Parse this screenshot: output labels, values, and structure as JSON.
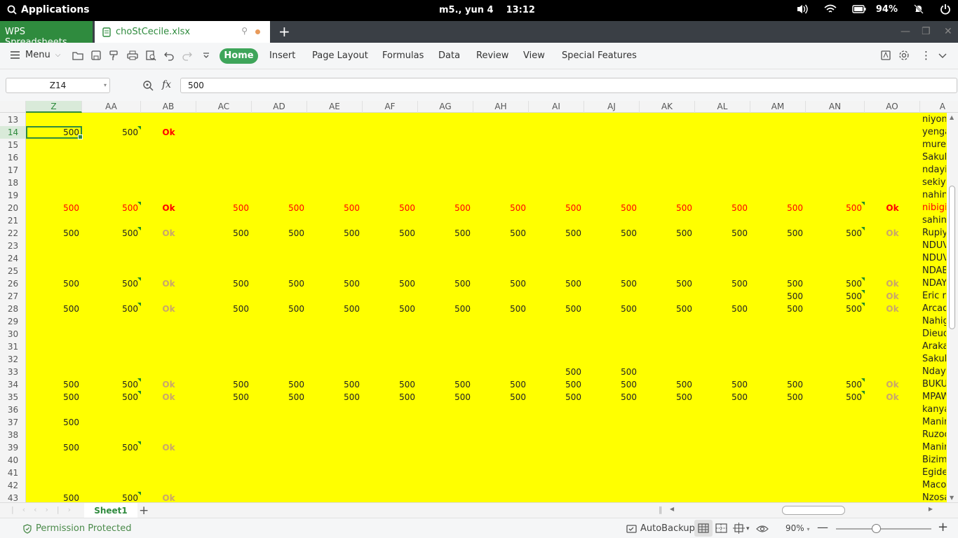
{
  "system": {
    "applications": "Applications",
    "date": "m5., yun  4",
    "time": "13:12",
    "battery": "94%"
  },
  "tabs": {
    "app": "WPS Spreadsheets",
    "file": "choStCecile.xlsx"
  },
  "ribbon": {
    "menu": "Menu",
    "items": [
      "Home",
      "Insert",
      "Page Layout",
      "Formulas",
      "Data",
      "Review",
      "View",
      "Special Features"
    ]
  },
  "formula_bar": {
    "cell_ref": "Z14",
    "fx": "fx",
    "value": "500"
  },
  "columns": [
    "Z",
    "AA",
    "AB",
    "AC",
    "AD",
    "AE",
    "AF",
    "AG",
    "AH",
    "AI",
    "AJ",
    "AK",
    "AL",
    "AM",
    "AN",
    "AO",
    "A"
  ],
  "rows": [
    "13",
    "14",
    "15",
    "16",
    "17",
    "18",
    "19",
    "20",
    "21",
    "22",
    "23",
    "24",
    "25",
    "26",
    "27",
    "28",
    "29",
    "30",
    "31",
    "32",
    "33",
    "34",
    "35",
    "36",
    "37",
    "38",
    "39",
    "40",
    "41",
    "42",
    "43"
  ],
  "cells": {
    "z14": "500",
    "aa14": "500",
    "ab14": "Ok",
    "z20": "500",
    "aa20": "500",
    "ab20": "Ok",
    "ac20": "500",
    "ad20": "500",
    "ae20": "500",
    "af20": "500",
    "ag20": "500",
    "ah20": "500",
    "ai20": "500",
    "aj20": "500",
    "ak20": "500",
    "al20": "500",
    "am20": "500",
    "an20": "500",
    "ao20": "Ok",
    "z22": "500",
    "aa22": "500",
    "ab22": "Ok",
    "ac22": "500",
    "ad22": "500",
    "ae22": "500",
    "af22": "500",
    "ag22": "500",
    "ah22": "500",
    "ai22": "500",
    "aj22": "500",
    "ak22": "500",
    "al22": "500",
    "am22": "500",
    "an22": "500",
    "ao22": "Ok",
    "z26": "500",
    "aa26": "500",
    "ab26": "Ok",
    "ac26": "500",
    "ad26": "500",
    "ae26": "500",
    "af26": "500",
    "ag26": "500",
    "ah26": "500",
    "ai26": "500",
    "aj26": "500",
    "ak26": "500",
    "al26": "500",
    "am26": "500",
    "an26": "500",
    "ao26": "Ok",
    "am27": "500",
    "an27": "500",
    "ao27": "Ok",
    "z28": "500",
    "aa28": "500",
    "ab28": "Ok",
    "ac28": "500",
    "ad28": "500",
    "ae28": "500",
    "af28": "500",
    "ag28": "500",
    "ah28": "500",
    "ai28": "500",
    "aj28": "500",
    "ak28": "500",
    "al28": "500",
    "am28": "500",
    "an28": "500",
    "ao28": "Ok",
    "ai33": "500",
    "aj33": "500",
    "z34": "500",
    "aa34": "500",
    "ab34": "Ok",
    "ac34": "500",
    "ad34": "500",
    "ae34": "500",
    "af34": "500",
    "ag34": "500",
    "ah34": "500",
    "ai34": "500",
    "aj34": "500",
    "ak34": "500",
    "al34": "500",
    "am34": "500",
    "an34": "500",
    "ao34": "Ok",
    "z35": "500",
    "aa35": "500",
    "ab35": "Ok",
    "ac35": "500",
    "ad35": "500",
    "ae35": "500",
    "af35": "500",
    "ag35": "500",
    "ah35": "500",
    "ai35": "500",
    "aj35": "500",
    "ak35": "500",
    "al35": "500",
    "am35": "500",
    "an35": "500",
    "ao35": "Ok",
    "z37": "500",
    "z39": "500",
    "aa39": "500",
    "ab39": "Ok",
    "z43": "500",
    "aa43": "500",
    "ab43": "Ok"
  },
  "names": [
    "niyon",
    "yenga",
    "mure",
    "Sakul",
    "ndayi",
    "sekiy",
    "nahin",
    "nibigi",
    "sahin",
    "Rupiy",
    "NDUV",
    "NDUV",
    "NDAB",
    "NDAY",
    "Eric r",
    "Arcad",
    "Nahig",
    "Dieud",
    "Araka",
    "Sakul",
    "Nday",
    "BUKU",
    "MPAW",
    "kanya",
    "Manir",
    "Ruzoo",
    "Manir",
    "Bizim",
    "Egide",
    "Maco",
    "Nzosa"
  ],
  "sheet": {
    "tab": "Sheet1"
  },
  "status": {
    "permission": "Permission Protected",
    "autobackup": "AutoBackup",
    "zoom": "90%"
  },
  "colors": {
    "accent": "#2f8b3e",
    "sheet_fill": "#ffff00",
    "highlight_text": "#ff0000",
    "ok_muted": "#c9a66b"
  }
}
